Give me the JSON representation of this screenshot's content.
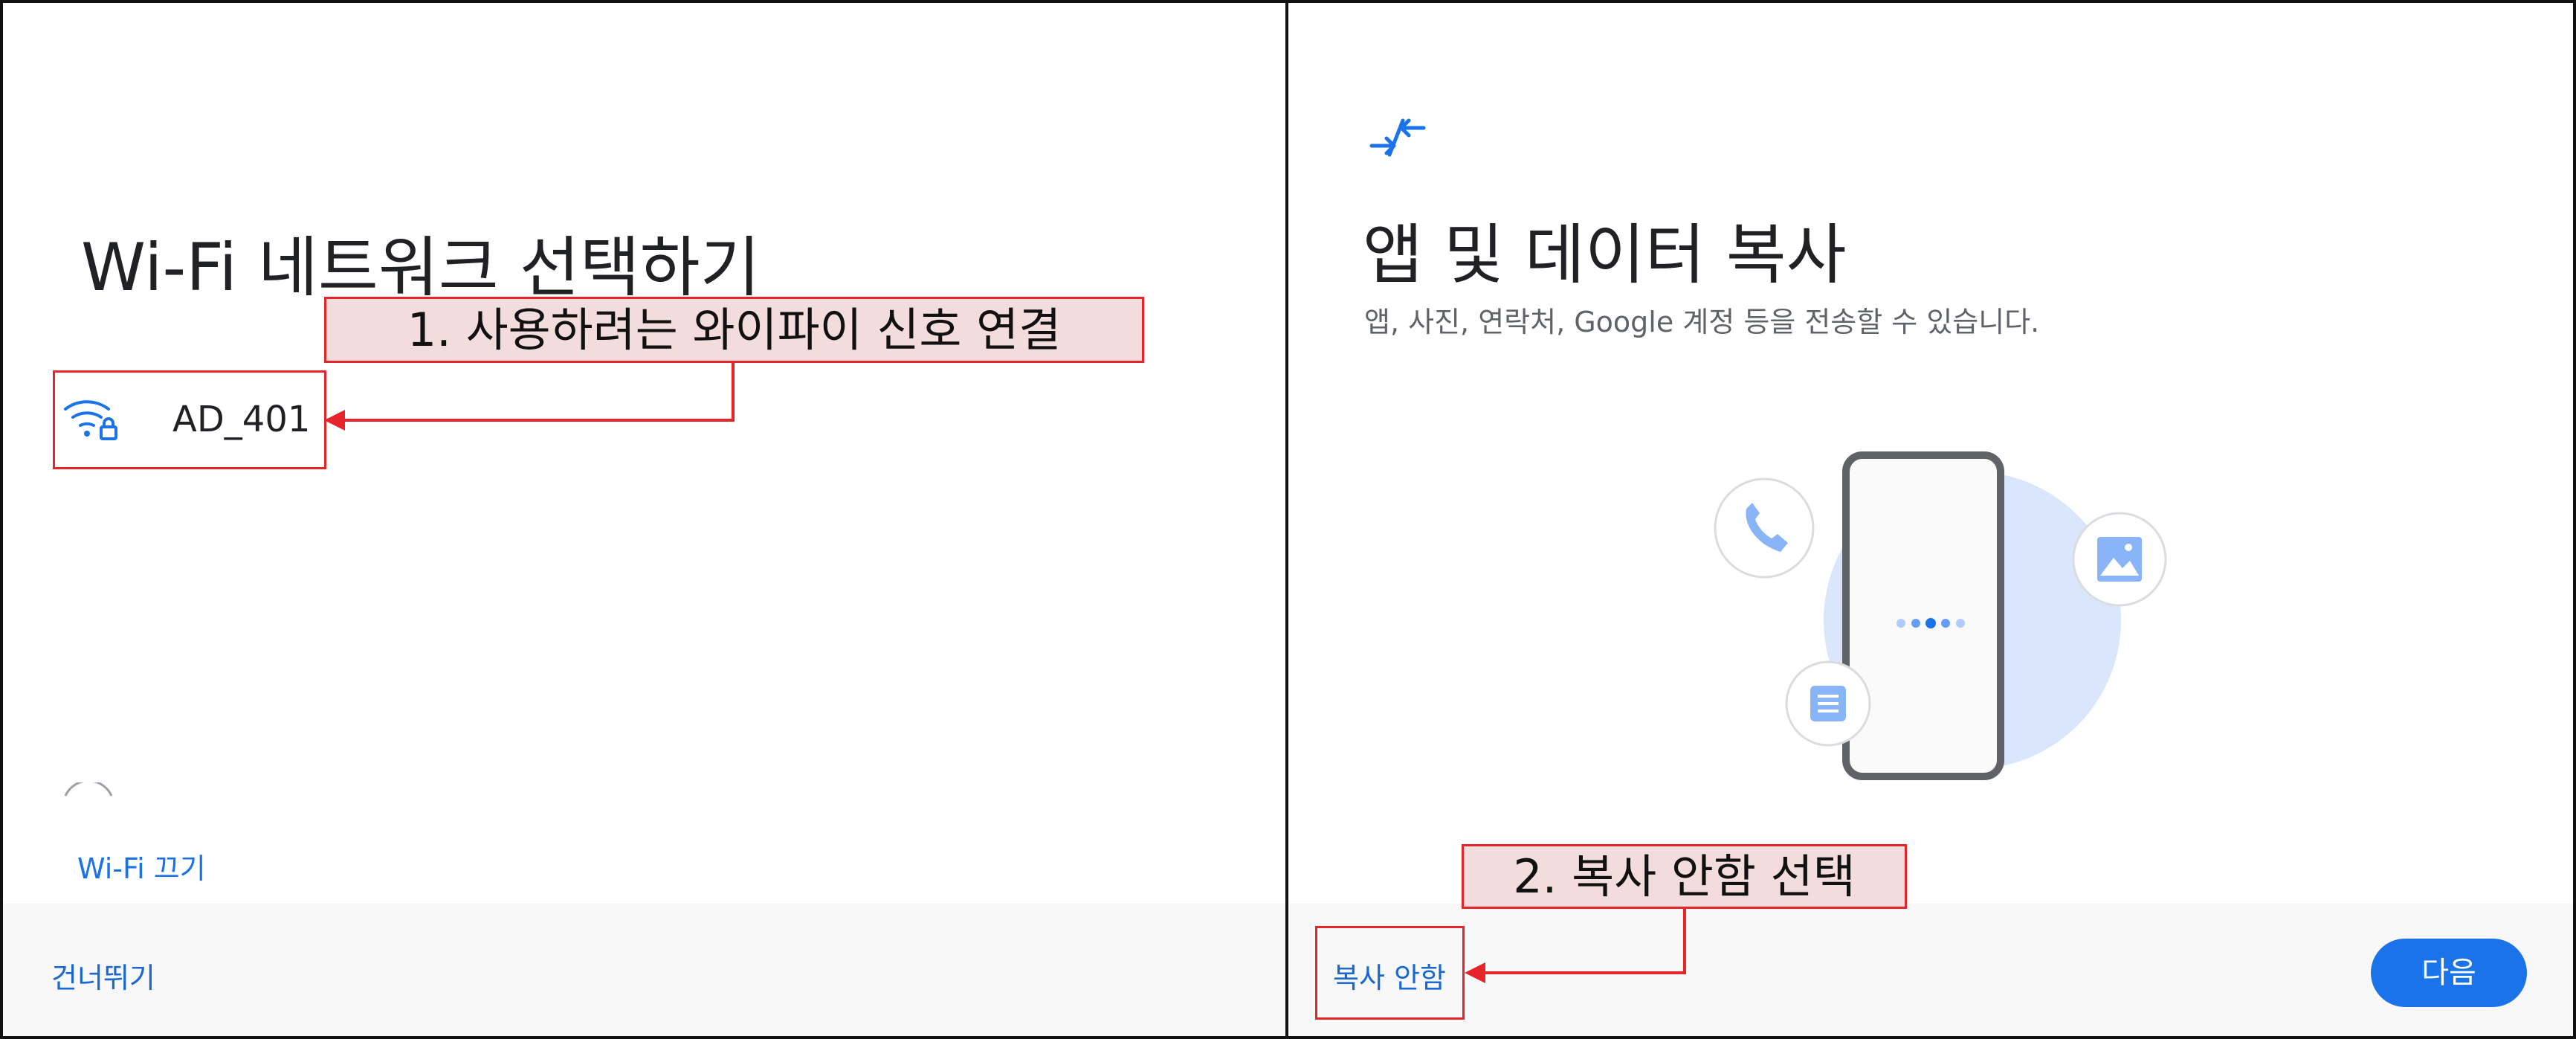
{
  "left_screen": {
    "title": "Wi-Fi 네트워크 선택하기",
    "network_name": "AD_401",
    "wifi_off_label": "Wi-Fi 끄기",
    "skip_label": "건너뛰기"
  },
  "right_screen": {
    "title": "앱 및 데이터 복사",
    "subtitle": "앱, 사진, 연락처, Google 계정 등을 전송할 수 있습니다.",
    "skip_copy_label": "복사 안함",
    "next_label": "다음"
  },
  "annotations": {
    "step1": "1. 사용하려는 와이파이 신호 연결",
    "step2": "2. 복사 안함 선택"
  },
  "colors": {
    "accent": "#1a73e8",
    "annotation_border": "#e5252a",
    "annotation_fill": "#f2dcdc",
    "footer_bg": "#f8f8f8"
  },
  "icons": {
    "wifi": "wifi-lock-icon",
    "copy": "copy-arrows-icon",
    "phone": "phone-icon",
    "image": "image-icon",
    "document": "document-icon"
  }
}
